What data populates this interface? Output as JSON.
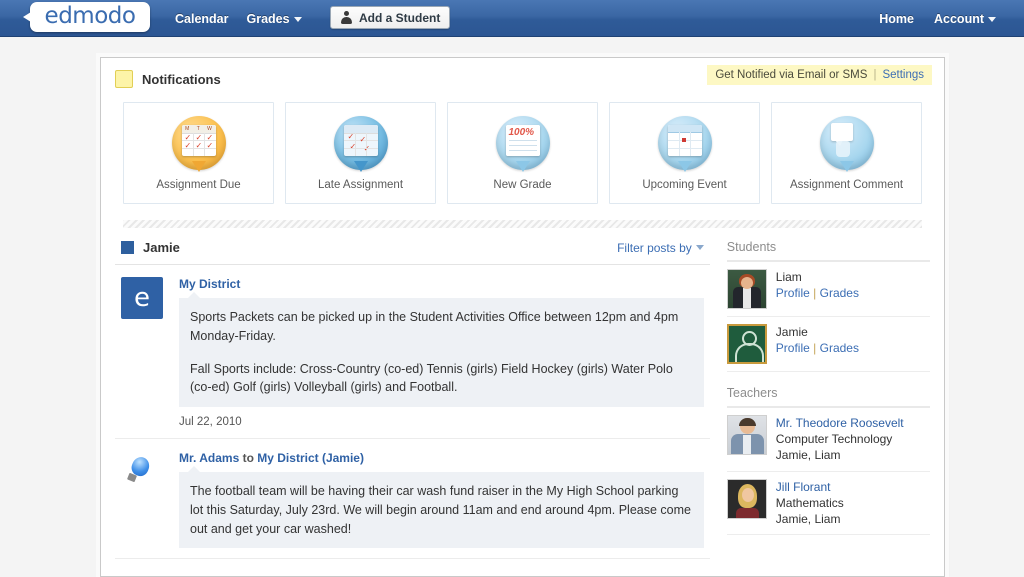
{
  "navbar": {
    "logo_text": "edmodo",
    "links": [
      {
        "label": "Calendar",
        "caret": false
      },
      {
        "label": "Grades",
        "caret": true
      }
    ],
    "add_student_label": "Add a Student",
    "right_links": [
      {
        "label": "Home",
        "caret": false
      },
      {
        "label": "Account",
        "caret": true
      }
    ]
  },
  "notifications": {
    "title": "Notifications",
    "get_notified_text": "Get Notified via Email or SMS",
    "separator": "|",
    "settings_label": "Settings",
    "cards": [
      {
        "label": "Assignment Due",
        "icon": "calendar-check-icon",
        "color": "#f0a733"
      },
      {
        "label": "Late Assignment",
        "icon": "late-calendar-icon",
        "color": "#4496cb"
      },
      {
        "label": "New Grade",
        "icon": "graded-paper-icon",
        "color": "#8cc7e7"
      },
      {
        "label": "Upcoming Event",
        "icon": "event-calendar-icon",
        "color": "#8cc7e7"
      },
      {
        "label": "Assignment Comment",
        "icon": "comment-bubble-icon",
        "color": "#8cc7e7"
      }
    ]
  },
  "feed": {
    "student_name": "Jamie",
    "filter_label": "Filter posts by",
    "posts": [
      {
        "avatar": "edmodo-e-avatar",
        "author": "My District",
        "to_text": "",
        "target": "",
        "paragraphs": [
          "Sports Packets can be picked up in the Student Activities Office between 12pm and 4pm Monday-Friday.",
          "Fall Sports include: Cross-Country (co-ed) Tennis (girls) Field Hockey (girls) Water Polo (co-ed) Golf (girls) Volleyball (girls) and Football."
        ],
        "date": "Jul 22, 2010"
      },
      {
        "avatar": "lightbulb-avatar",
        "author": "Mr. Adams",
        "to_text": "to",
        "target": "My District (Jamie)",
        "paragraphs": [
          "The football team will be having their car wash fund raiser in the My High School parking lot this Saturday, July 23rd. We will begin around 11am and end around 4pm. Please come out and get your car washed!"
        ],
        "date": ""
      }
    ]
  },
  "sidebar": {
    "students_heading": "Students",
    "students": [
      {
        "name": "Liam",
        "profile_label": "Profile",
        "separator": "|",
        "grades_label": "Grades",
        "thumb": "liam-photo"
      },
      {
        "name": "Jamie",
        "profile_label": "Profile",
        "separator": "|",
        "grades_label": "Grades",
        "thumb": "jamie-avatar"
      }
    ],
    "teachers_heading": "Teachers",
    "teachers": [
      {
        "name": "Mr. Theodore Roosevelt",
        "subject": "Computer Technology",
        "students": "Jamie, Liam",
        "thumb": "theodore-photo"
      },
      {
        "name": "Jill Florant",
        "subject": "Mathematics",
        "students": "Jamie, Liam",
        "thumb": "jill-photo"
      }
    ]
  }
}
